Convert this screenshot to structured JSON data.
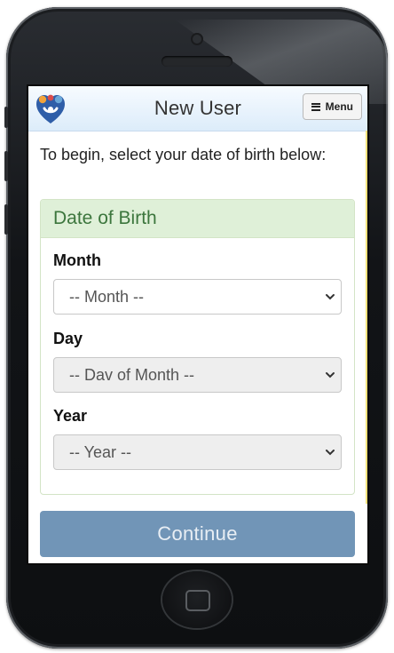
{
  "app": {
    "title": "New User",
    "menu_label": "Menu"
  },
  "intro_text": "To begin, select your date of birth below:",
  "panel": {
    "heading": "Date of Birth",
    "fields": {
      "month": {
        "label": "Month",
        "placeholder": "-- Month --",
        "enabled": true
      },
      "day": {
        "label": "Day",
        "placeholder": "-- Dav of Month --",
        "enabled": false
      },
      "year": {
        "label": "Year",
        "placeholder": "-- Year --",
        "enabled": false
      }
    }
  },
  "continue_label": "Continue",
  "colors": {
    "panel_heading_bg": "#dff0d8",
    "panel_heading_text": "#3c763d",
    "continue_bg": "#7195b7",
    "navbar_bg": "#dcecfa"
  },
  "icons": {
    "logo": "family-heart-logo-icon",
    "menu": "hamburger-icon",
    "select_arrow": "chevron-down-icon"
  }
}
